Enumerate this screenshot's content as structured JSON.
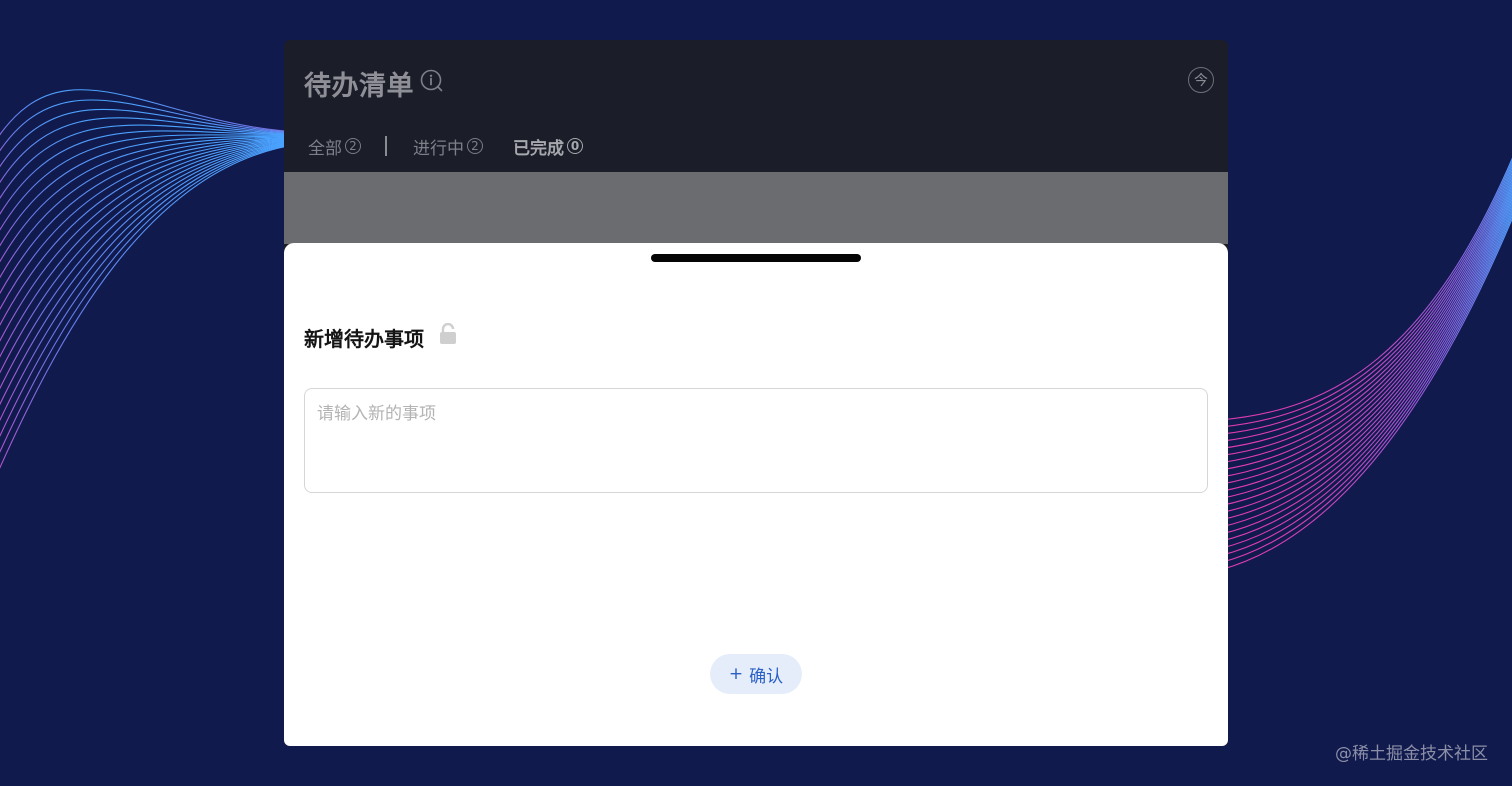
{
  "app": {
    "title": "待办清单",
    "info_icon": "info-icon",
    "today_label": "今"
  },
  "tabs": [
    {
      "label": "全部",
      "count": "2",
      "active": false
    },
    {
      "label": "进行中",
      "count": "2",
      "active": false
    },
    {
      "label": "已完成",
      "count": "0",
      "active": true
    }
  ],
  "sheet": {
    "title": "新增待办事项",
    "lock_icon": "unlocked-lock-icon",
    "input_placeholder": "请输入新的事项",
    "input_value": "",
    "confirm_label": "确认",
    "confirm_prefix": "+"
  },
  "watermark": "@稀土掘金技术社区",
  "colors": {
    "page_background": "#111a4c",
    "header_background": "#1b1e29",
    "sheet_background": "#ffffff",
    "accent_blue": "#2a5fc5",
    "button_bg": "#e5edfb",
    "wave_blue": "#4aa3ff",
    "wave_pink": "#e23bb0"
  }
}
